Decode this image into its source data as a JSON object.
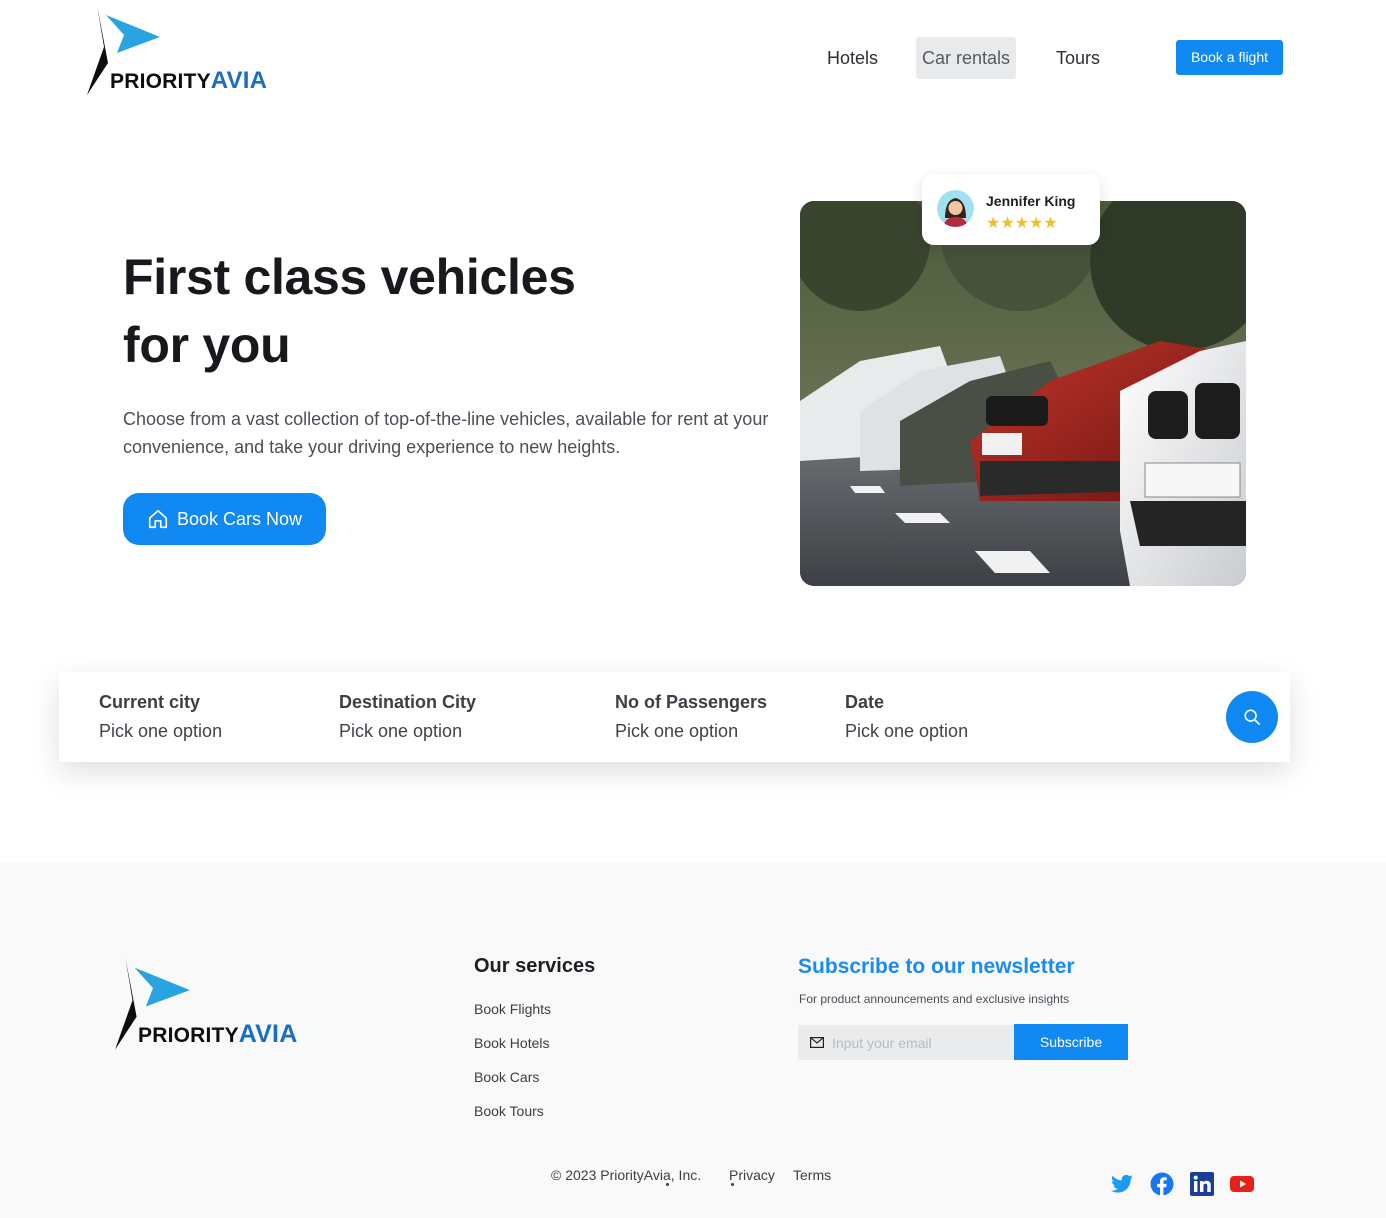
{
  "brand": {
    "word1": "PRIORITY",
    "word2": "AVIA"
  },
  "nav": {
    "items": [
      "Hotels",
      "Car rentals",
      "Tours"
    ],
    "active": "Car rentals",
    "cta": "Book a flight"
  },
  "hero": {
    "title_line1": "First class vehicles",
    "title_line2": "for you",
    "description": "Choose from a vast collection of top-of-the-line vehicles, available for rent at your convenience, and take your driving experience to new heights.",
    "cta": "Book Cars Now"
  },
  "review": {
    "name": "Jennifer King",
    "stars": "★★★★★",
    "rating": 5
  },
  "search": {
    "fields": [
      {
        "label": "Current city",
        "value": "Pick one option"
      },
      {
        "label": "Destination City",
        "value": "Pick one option"
      },
      {
        "label": "No of Passengers",
        "value": "Pick one option"
      },
      {
        "label": "Date",
        "value": "Pick one option"
      }
    ]
  },
  "footer": {
    "services_title": "Our services",
    "services": [
      "Book Flights",
      "Book Hotels",
      "Book Cars",
      "Book Tours"
    ],
    "newsletter_title": "Subscribe to our newsletter",
    "newsletter_sub": "For product announcements and exclusive insights",
    "email_placeholder": "Input your email",
    "subscribe": "Subscribe",
    "copyright": "© 2023 PriorityAvia, Inc.",
    "links": [
      "Privacy",
      "Terms"
    ],
    "social": [
      "twitter-icon",
      "facebook-icon",
      "linkedin-icon",
      "youtube-icon"
    ]
  },
  "colors": {
    "accent": "#1189f2",
    "logo_blue": "#1a6fc2",
    "star": "#f2bf2a",
    "footer_bg": "#f9f9f9"
  }
}
